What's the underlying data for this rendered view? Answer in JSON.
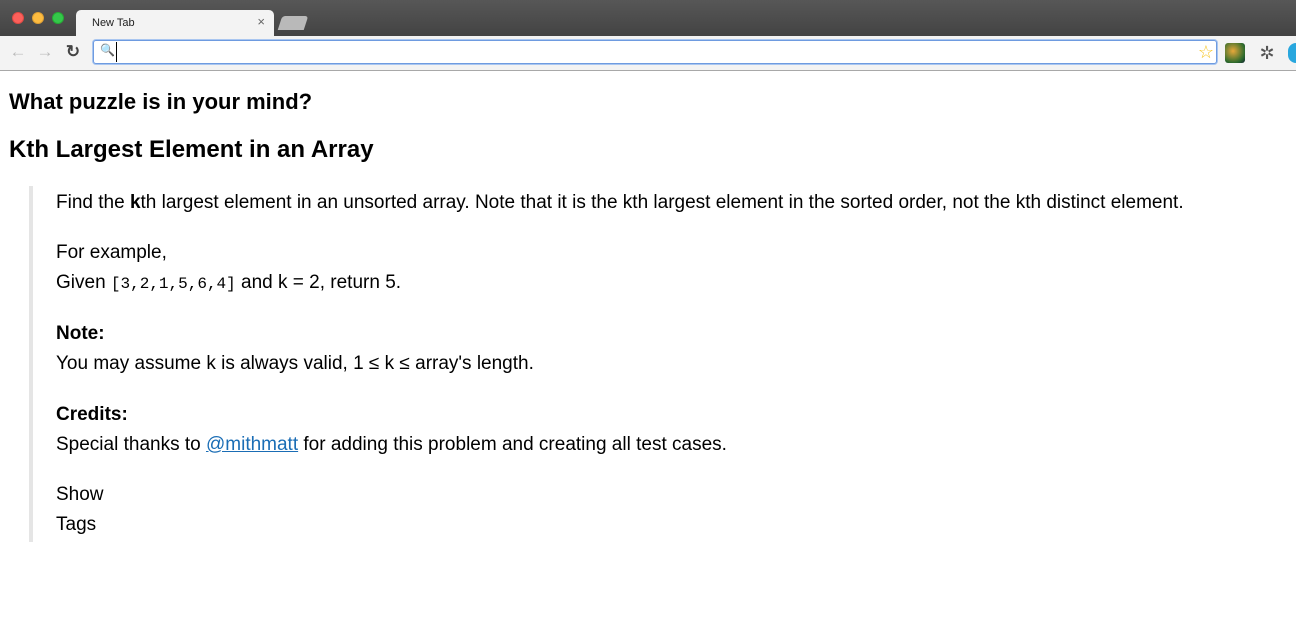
{
  "browser": {
    "tab_title": "New Tab",
    "tab_close": "×",
    "address_value": "",
    "icons": {
      "back": "back-arrow-icon",
      "forward": "forward-arrow-icon",
      "reload": "reload-icon",
      "search": "search-icon",
      "bookmark": "star-icon"
    }
  },
  "page": {
    "heading": "What puzzle is in your mind?",
    "problem_title": "Kth Largest Element in an Array",
    "statement_pre": "Find the ",
    "statement_bold": "k",
    "statement_post": "th largest element in an unsorted array. Note that it is the kth largest element in the sorted order, not the kth distinct element.",
    "example_label": "For example,",
    "example_given": "Given ",
    "example_array": "[3,2,1,5,6,4]",
    "example_rest": " and k = 2, return 5.",
    "note_label": "Note:",
    "note_text": "You may assume k is always valid, 1 ≤ k ≤ array's length.",
    "credits_label": "Credits:",
    "credits_pre": "Special thanks to ",
    "credits_link": "@mithmatt",
    "credits_post": " for adding this problem and creating all test cases.",
    "show_label": "Show",
    "tags_label": "Tags"
  }
}
